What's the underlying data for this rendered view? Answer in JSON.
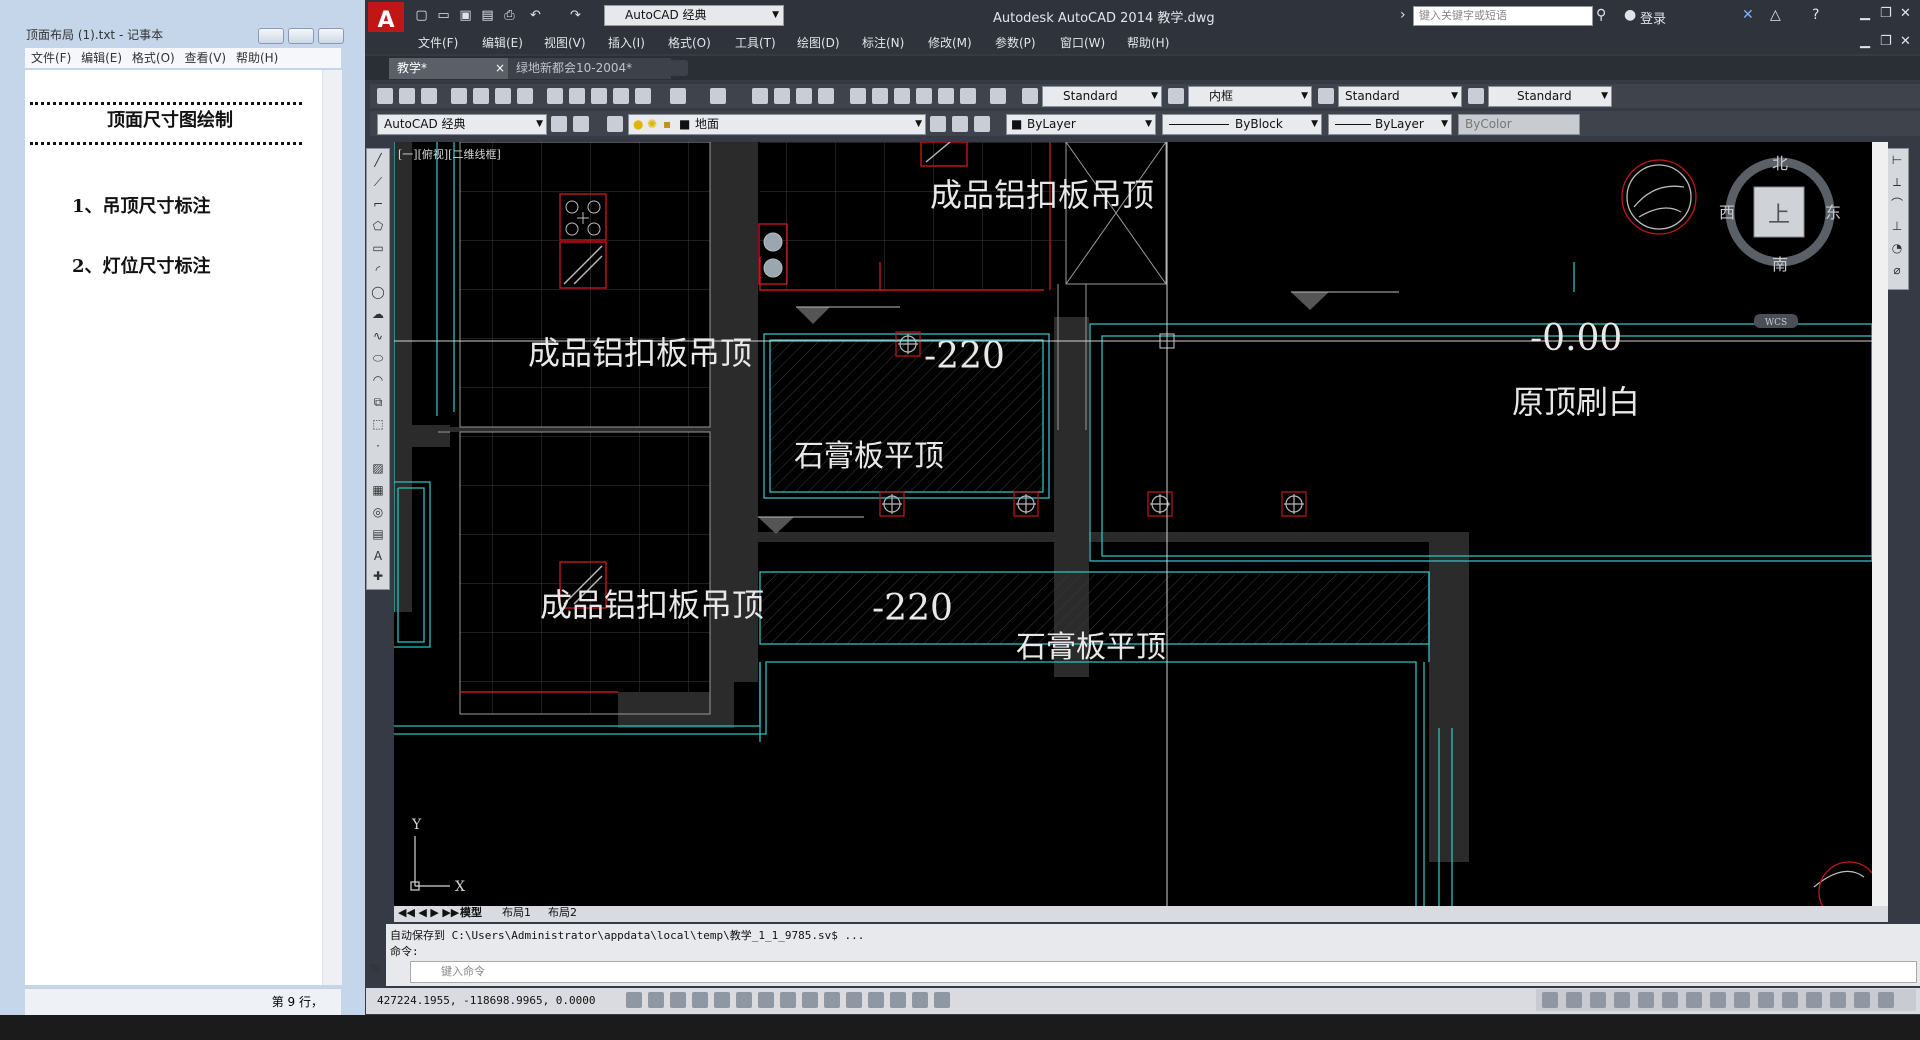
{
  "notepad": {
    "title": "顶面布局 (1).txt - 记事本",
    "menu": [
      "文件(F)",
      "编辑(E)",
      "格式(O)",
      "查看(V)",
      "帮助(H)"
    ],
    "heading": "顶面尺寸图绘制",
    "lines": [
      "1、吊顶尺寸标注",
      "2、灯位尺寸标注"
    ],
    "status": "第 9 行，"
  },
  "autocad": {
    "logo": "A",
    "workspace": "AutoCAD 经典",
    "app_title": "Autodesk AutoCAD 2014    教学.dwg",
    "search_placeholder": "键入关键字或短语",
    "login": "登录",
    "menu": [
      "文件(F)",
      "编辑(E)",
      "视图(V)",
      "插入(I)",
      "格式(O)",
      "工具(T)",
      "绘图(D)",
      "标注(N)",
      "修改(M)",
      "参数(P)",
      "窗口(W)",
      "帮助(H)"
    ],
    "tabs": [
      "教学*",
      "绿地新都会10-2004*"
    ],
    "styles": {
      "text_style": "Standard",
      "dim_style": "内框",
      "table_style": "Standard",
      "mleader_style": "Standard"
    },
    "workspace_combo": "AutoCAD 经典",
    "layer": "地面",
    "color": "ByLayer",
    "linetype": "ByBlock",
    "lineweight": "ByLayer",
    "plotstyle": "ByColor",
    "viewport_label": "[一][俯视][二维线框]",
    "viewcube": {
      "north": "北",
      "south": "南",
      "west": "西",
      "east": "东",
      "top": "上",
      "wcs": "WCS"
    },
    "drawing_labels": {
      "aluminum_1": "成品铝扣板吊顶",
      "aluminum_2": "成品铝扣板吊顶",
      "aluminum_3": "成品铝扣板吊顶",
      "gypsum_1": "石膏板平顶",
      "gypsum_2": "石膏板平顶",
      "original": "原顶刷白",
      "level_1": "-220",
      "level_2": "-220",
      "level_3": "-0.00"
    },
    "ucs": {
      "x": "X",
      "y": "Y"
    },
    "layout_tabs": [
      "模型",
      "布局1",
      "布局2"
    ],
    "command_history": "自动保存到 C:\\Users\\Administrator\\appdata\\local\\temp\\教学_1_1_9785.sv$ ...",
    "command_prompt": "命令:",
    "command_placeholder": "键入命令",
    "coordinates": "427224.1955, -118698.9965, 0.0000"
  }
}
